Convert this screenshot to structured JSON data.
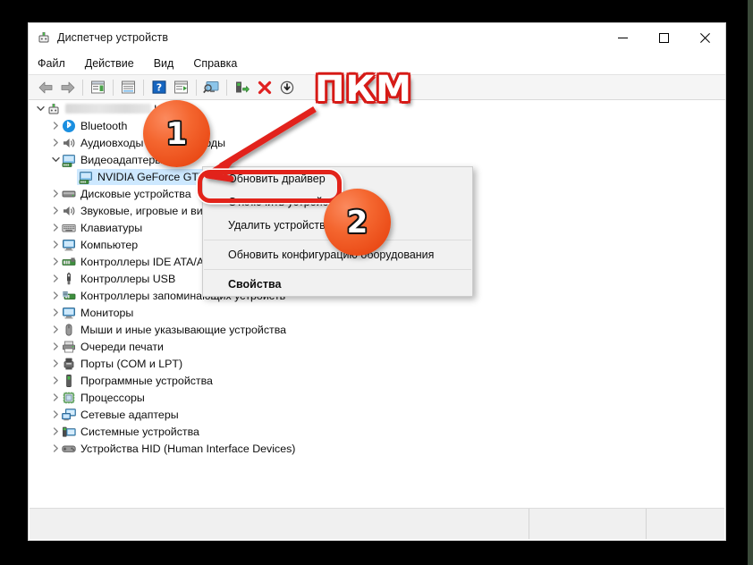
{
  "window": {
    "title": "Диспетчер устройств",
    "title_icon": "device-manager-icon",
    "controls": {
      "minimize": "—",
      "maximize": "□",
      "close": "✕"
    }
  },
  "menubar": {
    "items": [
      "Файл",
      "Действие",
      "Вид",
      "Справка"
    ]
  },
  "toolbar": {
    "items": [
      {
        "name": "back-icon",
        "glyph": "back"
      },
      {
        "name": "forward-icon",
        "glyph": "forward"
      },
      {
        "name": "separator",
        "glyph": "sep"
      },
      {
        "name": "properties-icon",
        "glyph": "props"
      },
      {
        "name": "separator",
        "glyph": "sep"
      },
      {
        "name": "show-hide-console-tree-icon",
        "glyph": "tree"
      },
      {
        "name": "separator",
        "glyph": "sep"
      },
      {
        "name": "help-icon",
        "glyph": "help"
      },
      {
        "name": "update-driver-icon",
        "glyph": "update"
      },
      {
        "name": "separator",
        "glyph": "sep"
      },
      {
        "name": "scan-monitor-icon",
        "glyph": "monitor"
      },
      {
        "name": "separator",
        "glyph": "sep"
      },
      {
        "name": "scan-hardware-changes-icon",
        "glyph": "scan"
      },
      {
        "name": "uninstall-device-icon",
        "glyph": "redx"
      },
      {
        "name": "disable-device-icon",
        "glyph": "down"
      }
    ]
  },
  "tree": {
    "root": {
      "label": "",
      "redacted": true,
      "suffix": "I6",
      "icon": "computer-root-icon",
      "expanded": true
    },
    "items": [
      {
        "label": "Bluetooth",
        "icon": "bluetooth-icon",
        "indent": 1,
        "expanded": false
      },
      {
        "label": "Аудиовходы и аудиовыходы",
        "icon": "audio-icon",
        "indent": 1,
        "expanded": false
      },
      {
        "label": "Видеоадаптеры",
        "icon": "display-adapter-icon",
        "indent": 1,
        "expanded": true
      },
      {
        "label": "NVIDIA GeForce GTX",
        "icon": "display-adapter-icon",
        "indent": 2,
        "selected": true
      },
      {
        "label": "Дисковые устройства",
        "icon": "disk-drive-icon",
        "indent": 1,
        "expanded": false
      },
      {
        "label": "Звуковые, игровые и видеоустройства",
        "icon": "audio-icon",
        "indent": 1,
        "expanded": false
      },
      {
        "label": "Клавиатуры",
        "icon": "keyboard-icon",
        "indent": 1,
        "expanded": false
      },
      {
        "label": "Компьютер",
        "icon": "computer-icon",
        "indent": 1,
        "expanded": false
      },
      {
        "label": "Контроллеры IDE ATA/ATAPI",
        "icon": "ide-controller-icon",
        "indent": 1,
        "expanded": false
      },
      {
        "label": "Контроллеры USB",
        "icon": "usb-icon",
        "indent": 1,
        "expanded": false
      },
      {
        "label": "Контроллеры запоминающих устройств",
        "icon": "storage-controller-icon",
        "indent": 1,
        "expanded": false
      },
      {
        "label": "Мониторы",
        "icon": "monitor-icon",
        "indent": 1,
        "expanded": false
      },
      {
        "label": "Мыши и иные указывающие устройства",
        "icon": "mouse-icon",
        "indent": 1,
        "expanded": false
      },
      {
        "label": "Очереди печати",
        "icon": "printer-icon",
        "indent": 1,
        "expanded": false
      },
      {
        "label": "Порты (COM и LPT)",
        "icon": "port-icon",
        "indent": 1,
        "expanded": false
      },
      {
        "label": "Программные устройства",
        "icon": "software-device-icon",
        "indent": 1,
        "expanded": false
      },
      {
        "label": "Процессоры",
        "icon": "processor-icon",
        "indent": 1,
        "expanded": false
      },
      {
        "label": "Сетевые адаптеры",
        "icon": "network-adapter-icon",
        "indent": 1,
        "expanded": false
      },
      {
        "label": "Системные устройства",
        "icon": "system-device-icon",
        "indent": 1,
        "expanded": false
      },
      {
        "label": "Устройства HID (Human Interface Devices)",
        "icon": "hid-icon",
        "indent": 1,
        "expanded": false
      }
    ]
  },
  "context_menu": {
    "items": [
      {
        "label": "Обновить драйвер",
        "highlighted": true
      },
      {
        "label": "Отключить устройство"
      },
      {
        "label": "Удалить устройство"
      },
      {
        "separator": true
      },
      {
        "label": "Обновить конфигурацию оборудования"
      },
      {
        "separator": true
      },
      {
        "label": "Свойства",
        "bold": true
      }
    ]
  },
  "annotations": {
    "label": "ПКМ",
    "badges": [
      {
        "text": "1"
      },
      {
        "text": "2"
      }
    ],
    "colors": {
      "red": "#e2231a",
      "orange": "#ea4a16",
      "selection": "#cde8ff"
    }
  },
  "status_bar": {
    "panes": [
      "",
      "",
      ""
    ]
  }
}
